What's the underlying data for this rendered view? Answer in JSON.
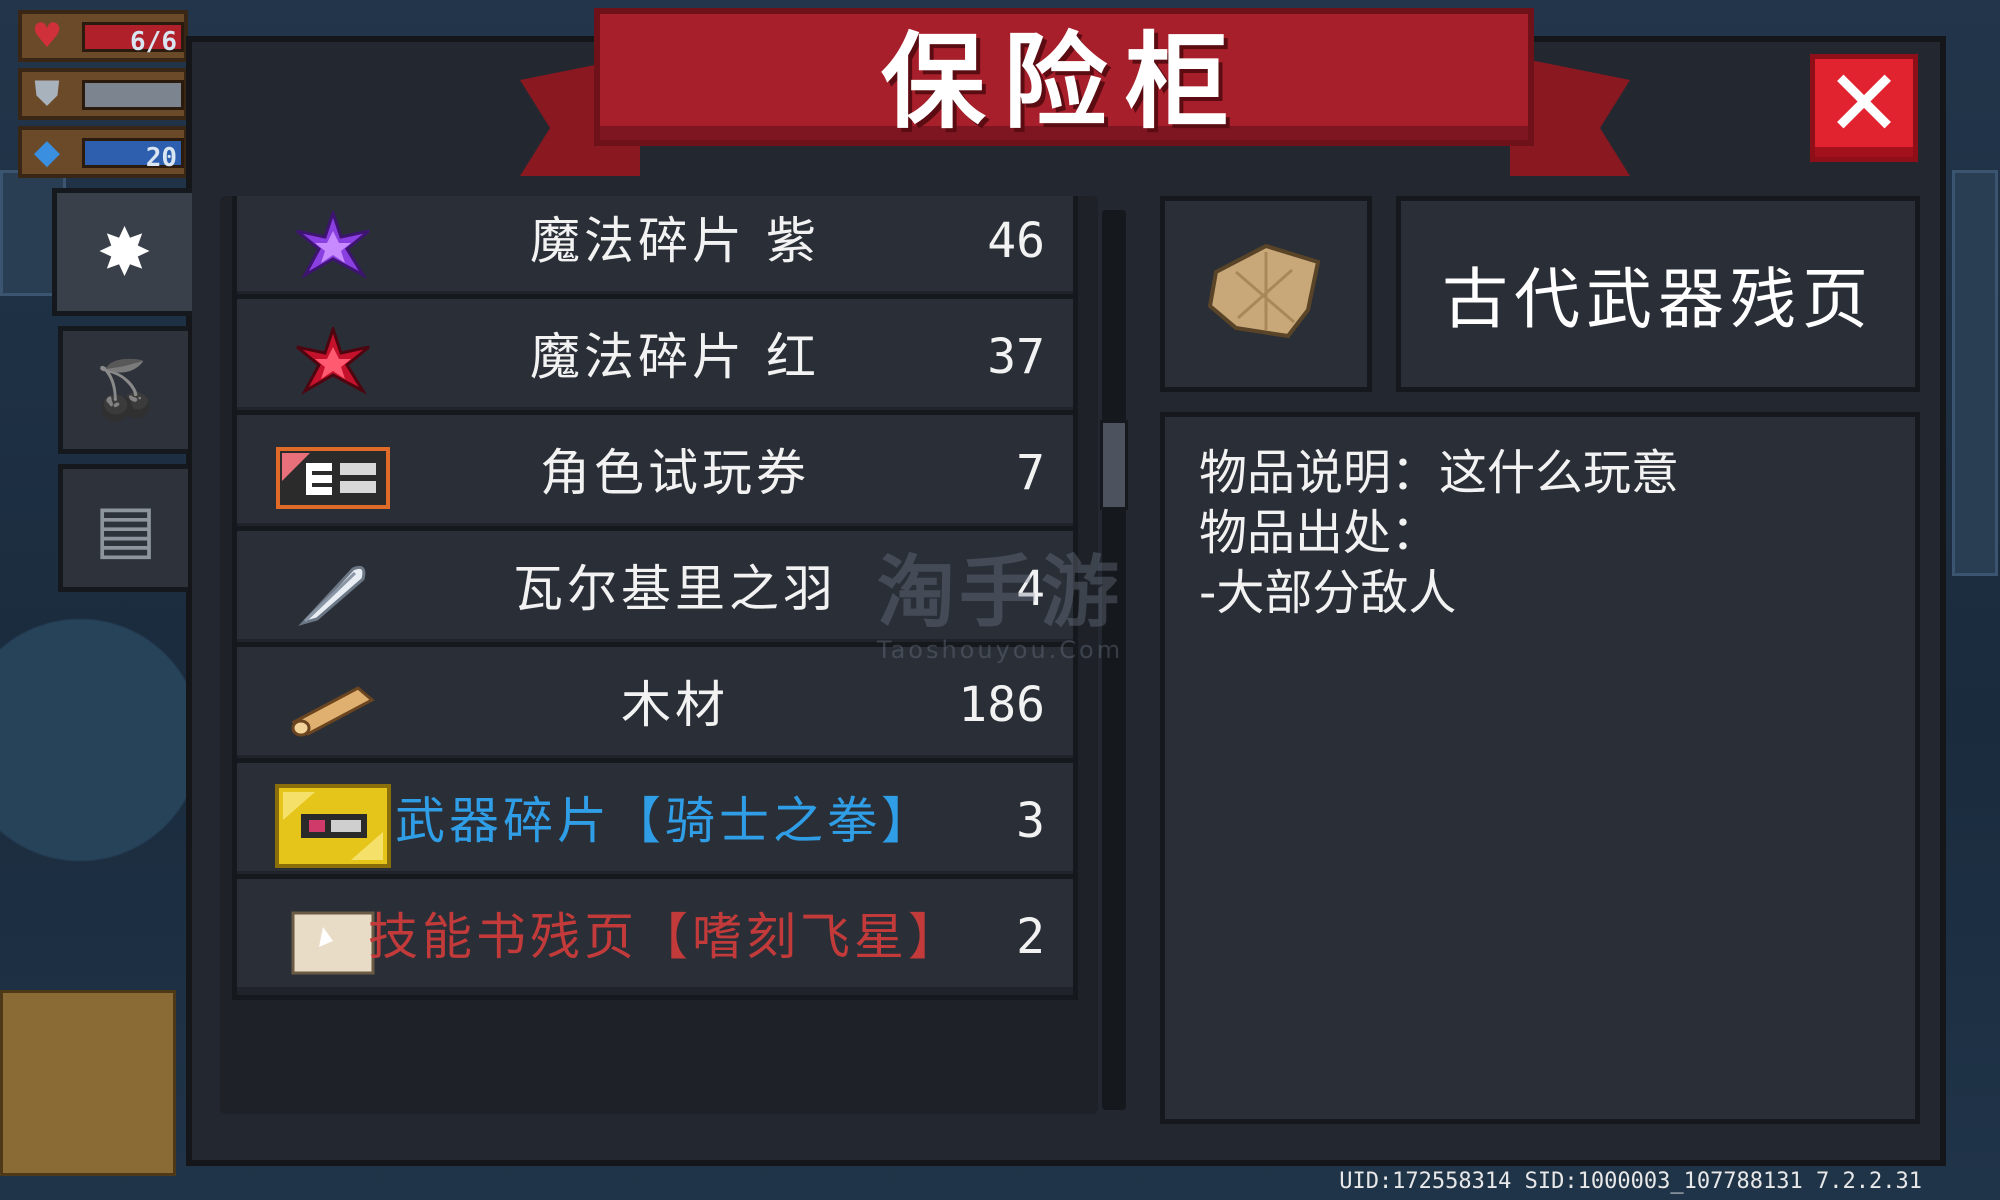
{
  "hud": {
    "health_value": "6/6",
    "armor_value": "",
    "energy_value": "20"
  },
  "window": {
    "title": "保险柜",
    "close_glyph": "✕"
  },
  "tabs": [
    {
      "icon": "magic-crystal-icon",
      "glyph": "✸",
      "active": true
    },
    {
      "icon": "fruit-icon",
      "glyph": "🍒",
      "active": false
    },
    {
      "icon": "ticket-icon",
      "glyph": "▤",
      "active": false
    }
  ],
  "items": [
    {
      "name": "魔法碎片 紫",
      "count": "46",
      "icon": "purple-crystal-icon",
      "color": "#f2f2f2"
    },
    {
      "name": "魔法碎片 红",
      "count": "37",
      "icon": "red-crystal-icon",
      "color": "#f2f2f2"
    },
    {
      "name": "角色试玩券",
      "count": "7",
      "icon": "trial-card-icon",
      "color": "#f2f2f2"
    },
    {
      "name": "瓦尔基里之羽",
      "count": "4",
      "icon": "feather-icon",
      "color": "#f2f2f2"
    },
    {
      "name": "木材",
      "count": "186",
      "icon": "wood-log-icon",
      "color": "#f2f2f2"
    },
    {
      "name": "武器碎片【骑士之拳】",
      "count": "3",
      "icon": "weapon-fragment-icon",
      "color": "#2f9ee6"
    },
    {
      "name": "技能书残页【嗜刻飞星】",
      "count": "2",
      "icon": "skill-scroll-icon",
      "color": "#c23a3a"
    }
  ],
  "detail": {
    "name": "古代武器残页",
    "icon": "ancient-page-icon",
    "lines": [
      "物品说明：这什么玩意",
      "物品出处：",
      "-大部分敌人"
    ]
  },
  "watermark": {
    "cn": "淘手游",
    "en": "Taoshouyou.Com"
  },
  "footer": "UID:172558314 SID:1000003_107788131 7.2.2.31"
}
